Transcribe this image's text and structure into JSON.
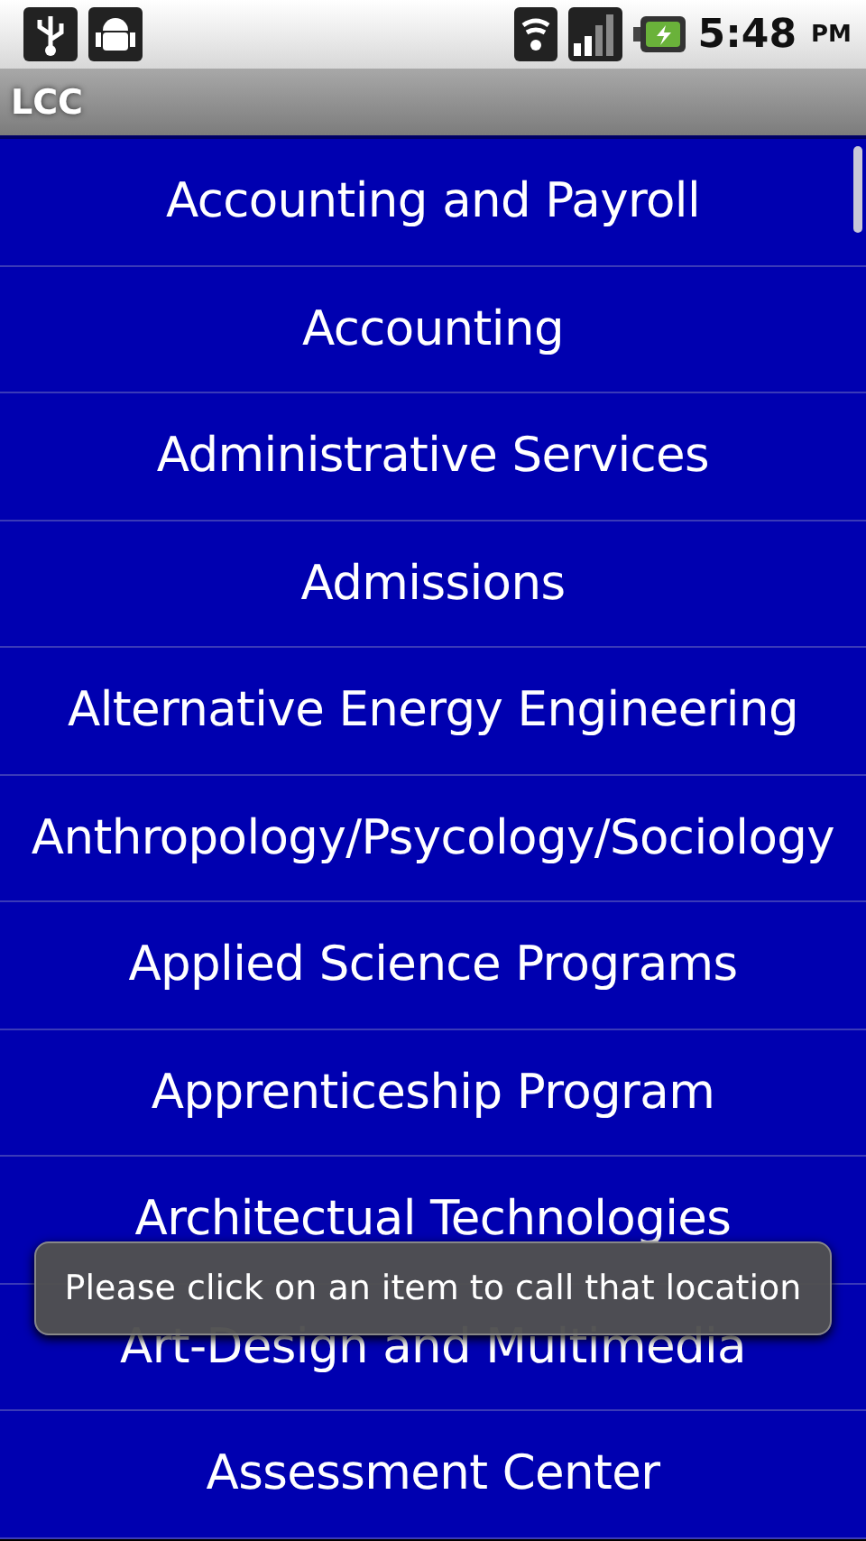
{
  "status_bar": {
    "time": "5:48",
    "ampm": "PM"
  },
  "title_bar": {
    "title": "LCC"
  },
  "list": {
    "items": [
      {
        "label": "Accounting and Payroll"
      },
      {
        "label": "Accounting"
      },
      {
        "label": "Administrative Services"
      },
      {
        "label": "Admissions"
      },
      {
        "label": "Alternative Energy Engineering"
      },
      {
        "label": "Anthropology/Psycology/Sociology"
      },
      {
        "label": "Applied Science Programs"
      },
      {
        "label": "Apprenticeship Program"
      },
      {
        "label": "Architectual Technologies"
      },
      {
        "label": "Art-Design and Multimedia"
      },
      {
        "label": "Assessment Center"
      }
    ]
  },
  "toast": {
    "message": "Please click on an item to call that location"
  }
}
